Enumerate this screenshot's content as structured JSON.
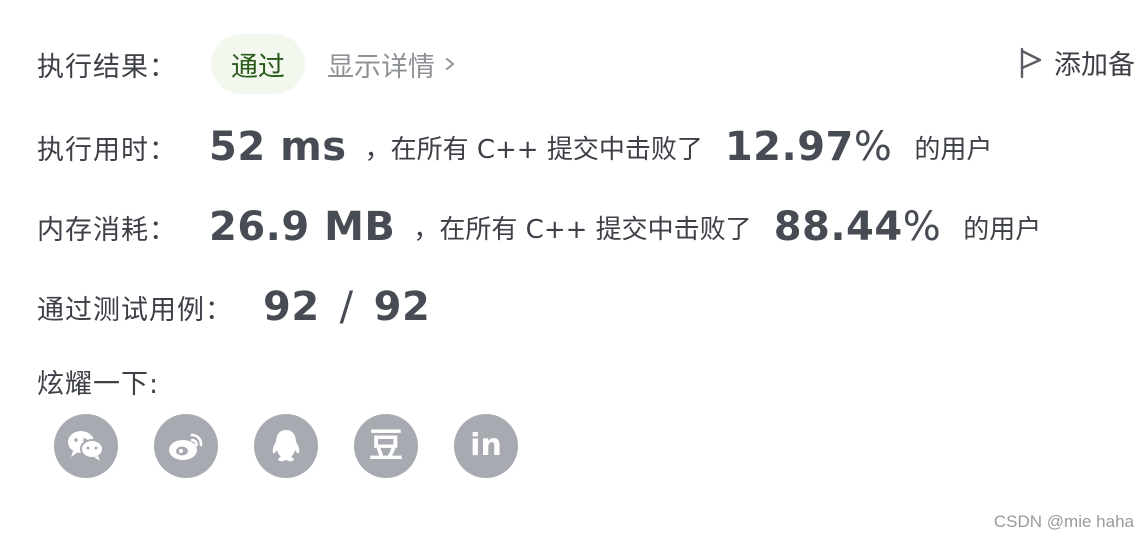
{
  "result": {
    "label": "执行结果：",
    "status": "通过",
    "details_link": "显示详情",
    "add_note": "添加备"
  },
  "runtime": {
    "label": "执行用时：",
    "value": "52 ms",
    "text": "，在所有 C++ 提交中击败了",
    "percent": "12.97",
    "percent_sign": "%",
    "suffix": "的用户"
  },
  "memory": {
    "label": "内存消耗：",
    "value": "26.9 MB",
    "text": "，在所有 C++ 提交中击败了",
    "percent": "88.44",
    "percent_sign": "%",
    "suffix": "的用户"
  },
  "testcases": {
    "label": "通过测试用例：",
    "passed": "92",
    "separator": "/",
    "total": "92"
  },
  "share": {
    "label": "炫耀一下:",
    "buttons": [
      "wechat-icon",
      "weibo-icon",
      "qq-icon",
      "douban-icon",
      "linkedin-icon"
    ],
    "douban_glyph": "豆",
    "linkedin_glyph": "in"
  },
  "watermark": "CSDN @mie haha",
  "colors": {
    "badge_bg": "#f3f8ef",
    "badge_text": "#2a5a1c",
    "icon_bg": "#a8aab1",
    "muted": "#8e9196"
  }
}
